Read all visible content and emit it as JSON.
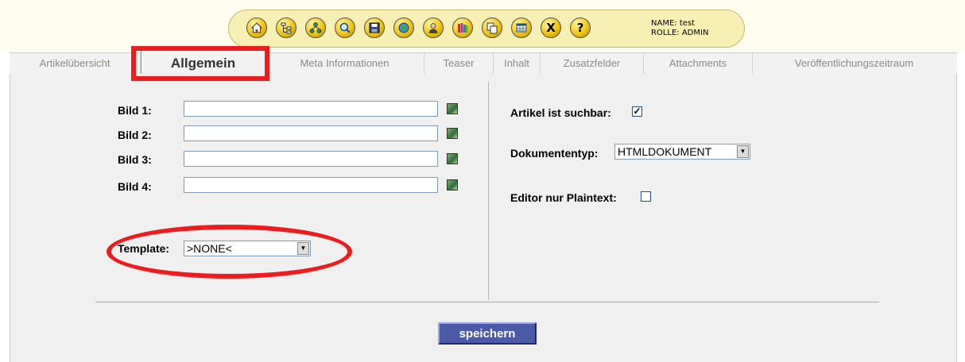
{
  "toolbar": {
    "buttons": [
      {
        "name": "home-icon"
      },
      {
        "name": "tree-icon"
      },
      {
        "name": "sitemap-icon"
      },
      {
        "name": "search-icon"
      },
      {
        "name": "save-icon"
      },
      {
        "name": "globe-icon"
      },
      {
        "name": "user-icon"
      },
      {
        "name": "books-icon"
      },
      {
        "name": "copy-icon"
      },
      {
        "name": "table-icon"
      },
      {
        "name": "logout-icon",
        "glyph": "X"
      },
      {
        "name": "help-icon",
        "glyph": "?"
      }
    ],
    "user_name": "NAME: test",
    "user_role": "ROLLE: ADMIN"
  },
  "tabs": [
    {
      "label": "Artikelübersicht"
    },
    {
      "label": "Allgemein",
      "active": true
    },
    {
      "label": "Meta Informationen"
    },
    {
      "label": "Teaser"
    },
    {
      "label": "Inhalt"
    },
    {
      "label": "Zusatzfelder"
    },
    {
      "label": "Attachments"
    },
    {
      "label": "Veröffentlichungszeitraum"
    }
  ],
  "left": {
    "images": [
      {
        "label": "Bild 1:",
        "value": ""
      },
      {
        "label": "Bild 2:",
        "value": ""
      },
      {
        "label": "Bild 3:",
        "value": ""
      },
      {
        "label": "Bild 4:",
        "value": ""
      }
    ],
    "template_label": "Template:",
    "template_value": ">NONE<"
  },
  "right": {
    "searchable_label": "Artikel ist suchbar:",
    "searchable_checked": true,
    "doctype_label": "Dokumententyp:",
    "doctype_value": "HTMLDOKUMENT",
    "plaintext_label": "Editor nur Plaintext:",
    "plaintext_checked": false
  },
  "save_label": "speichern",
  "colors": {
    "highlight": "#ee1c1c",
    "save_button": "#4a5aa8",
    "panel_bg": "#f0f0f0",
    "toolbar_bg": "#f7efb4"
  }
}
